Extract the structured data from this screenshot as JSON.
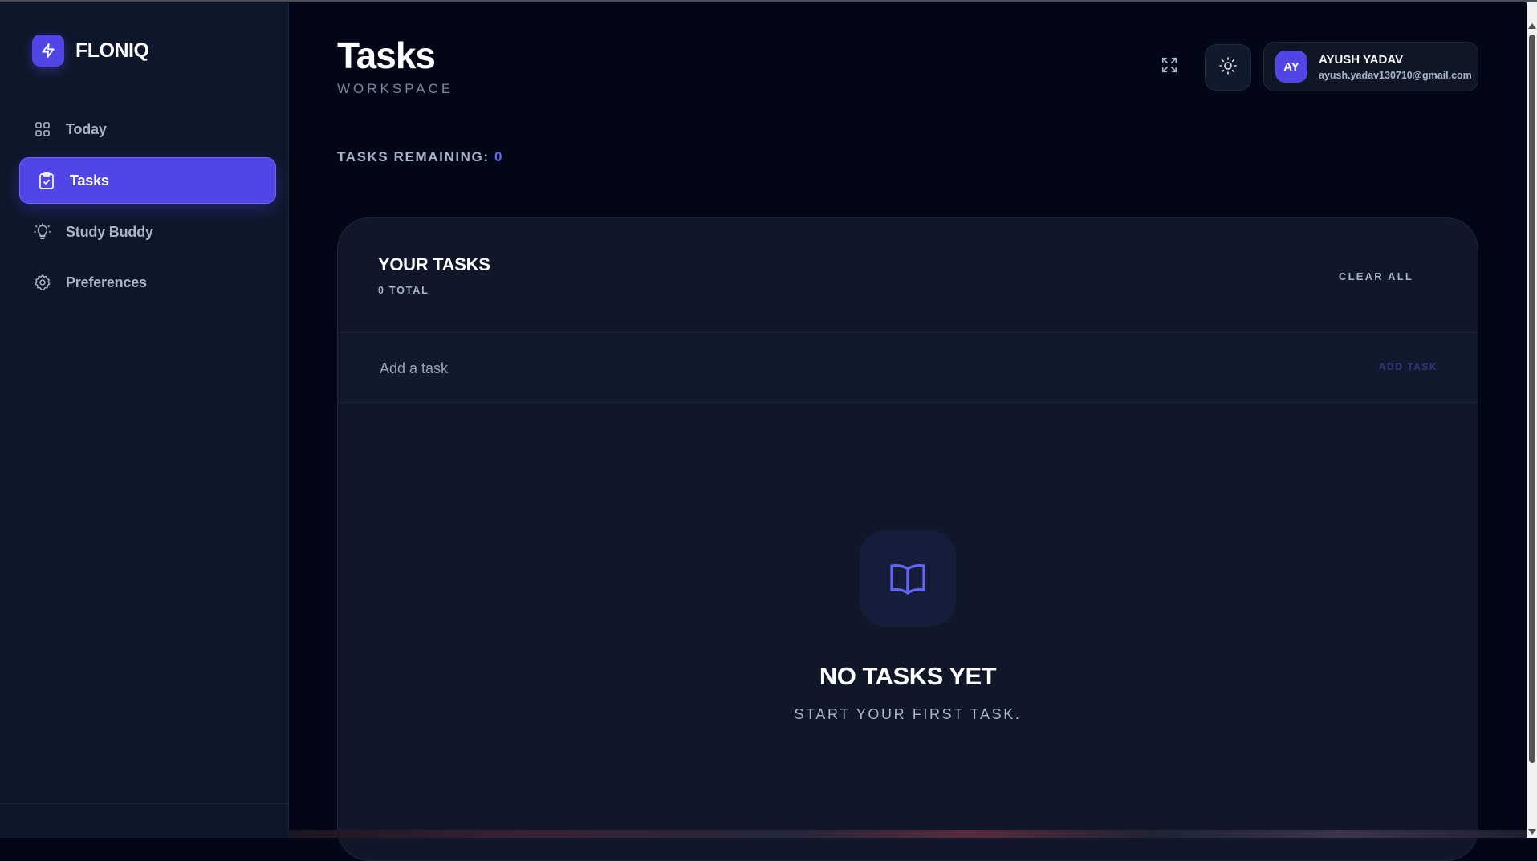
{
  "app": {
    "name": "FLONIQ"
  },
  "sidebar": {
    "items": [
      {
        "label": "Today",
        "icon": "grid-icon",
        "active": false
      },
      {
        "label": "Tasks",
        "icon": "clipboard-check-icon",
        "active": true
      },
      {
        "label": "Study Buddy",
        "icon": "lightbulb-icon",
        "active": false
      },
      {
        "label": "Preferences",
        "icon": "gear-icon",
        "active": false
      }
    ]
  },
  "header": {
    "title": "Tasks",
    "subtitle": "WORKSPACE"
  },
  "user": {
    "initials": "AY",
    "name": "AYUSH YADAV",
    "email": "ayush.yadav130710@gmail.com"
  },
  "summary": {
    "remaining_label": "TASKS REMAINING:",
    "remaining_count": "0"
  },
  "tasks_panel": {
    "title": "YOUR TASKS",
    "total": "0 TOTAL",
    "clear_all": "CLEAR ALL",
    "input_placeholder": "Add a task",
    "add_button": "ADD TASK",
    "empty_title": "NO TASKS YET",
    "empty_subtitle": "START YOUR FIRST TASK."
  },
  "colors": {
    "accent": "#4f46e5",
    "background": "#030616",
    "sidebar": "#0e1629",
    "panel": "#0f1729"
  }
}
